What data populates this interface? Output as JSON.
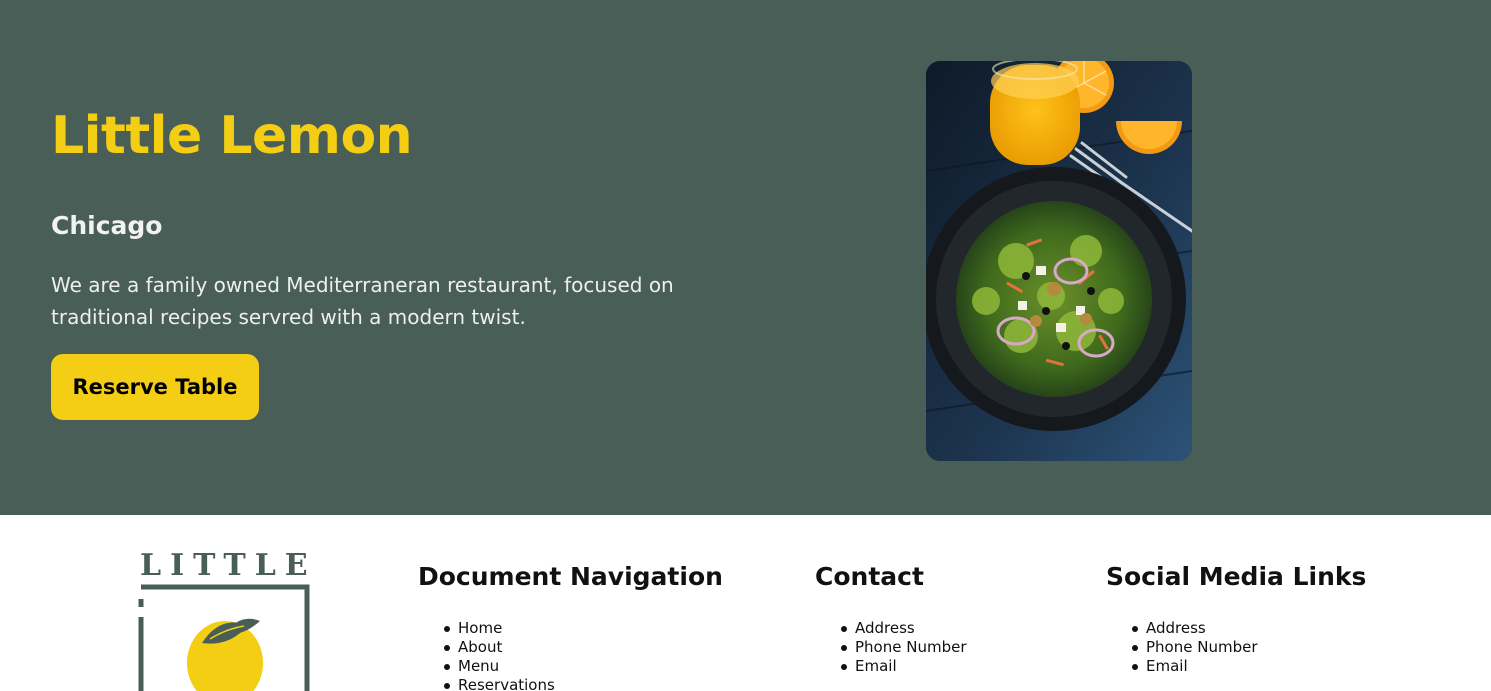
{
  "hero": {
    "title": "Little Lemon",
    "subtitle": "Chicago",
    "description": "We are a family owned Mediterraneran restaurant, focused on traditional recipes servred with a modern twist.",
    "reserve_label": "Reserve Table",
    "image_icon": "salad-photo"
  },
  "footer": {
    "logo_text": "LITTLE",
    "logo_icon": "lemon-icon",
    "navigation": {
      "heading": "Document Navigation",
      "items": [
        "Home",
        "About",
        "Menu",
        "Reservations"
      ]
    },
    "contact": {
      "heading": "Contact",
      "items": [
        "Address",
        "Phone Number",
        "Email"
      ]
    },
    "social": {
      "heading": "Social Media Links",
      "items": [
        "Address",
        "Phone Number",
        "Email"
      ]
    }
  },
  "colors": {
    "primary_green": "#495e57",
    "primary_yellow": "#f4ce14",
    "text_light": "#edefee",
    "text_dark": "#111111"
  }
}
